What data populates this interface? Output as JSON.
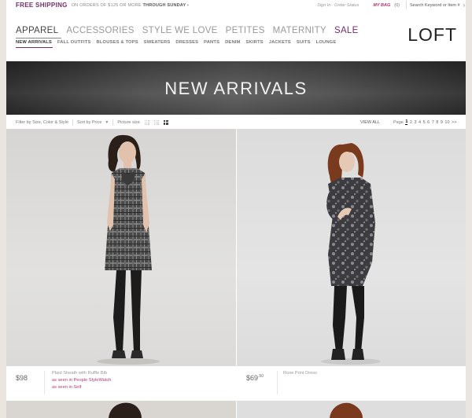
{
  "promo": {
    "headline": "FREE SHIPPING",
    "detail_prefix": "ON ORDERS OF $125 OR MORE",
    "detail_suffix": "THROUGH SUNDAY ›",
    "signin": "Sign In · Order Status",
    "mybag": "MY BAG",
    "bag_count": "(0)",
    "search_placeholder": "Search Keyword or Item #"
  },
  "nav": {
    "main": [
      "APPAREL",
      "ACCESSORIES",
      "STYLE WE LOVE",
      "PETITES",
      "MATERNITY",
      "SALE"
    ],
    "sub": [
      "NEW ARRIVALS",
      "FALL OUTFITS",
      "BLOUSES & TOPS",
      "SWEATERS",
      "DRESSES",
      "PANTS",
      "DENIM",
      "SKIRTS",
      "JACKETS",
      "SUITS",
      "LOUNGE"
    ]
  },
  "logo": "LOFT",
  "banner_title": "NEW ARRIVALS",
  "filters": {
    "filter_label": "Filter by Size, Color & Style",
    "sort_label": "Sort by Price",
    "picture_size_label": "Picture size",
    "view_all": "VIEW ALL",
    "page_label": "Page",
    "pages": [
      "1",
      "2",
      "3",
      "4",
      "5",
      "6",
      "7",
      "8",
      "9",
      "10"
    ],
    "next": ">>",
    "current_page": "1"
  },
  "products": [
    {
      "price": "$98",
      "price_cents": "",
      "name": "Plaid Sheath with Ruffle Bib",
      "seen_in_1": "as seen in People StyleWatch",
      "seen_in_2": "as seen in Self"
    },
    {
      "price": "$69",
      "price_cents": ".50",
      "name": "Rose Print Dress"
    }
  ],
  "colors": {
    "brand_purple": "#7a2b6d",
    "seen_in_pink": "#b03a7a",
    "banner_dark": "#2c2c2c"
  }
}
